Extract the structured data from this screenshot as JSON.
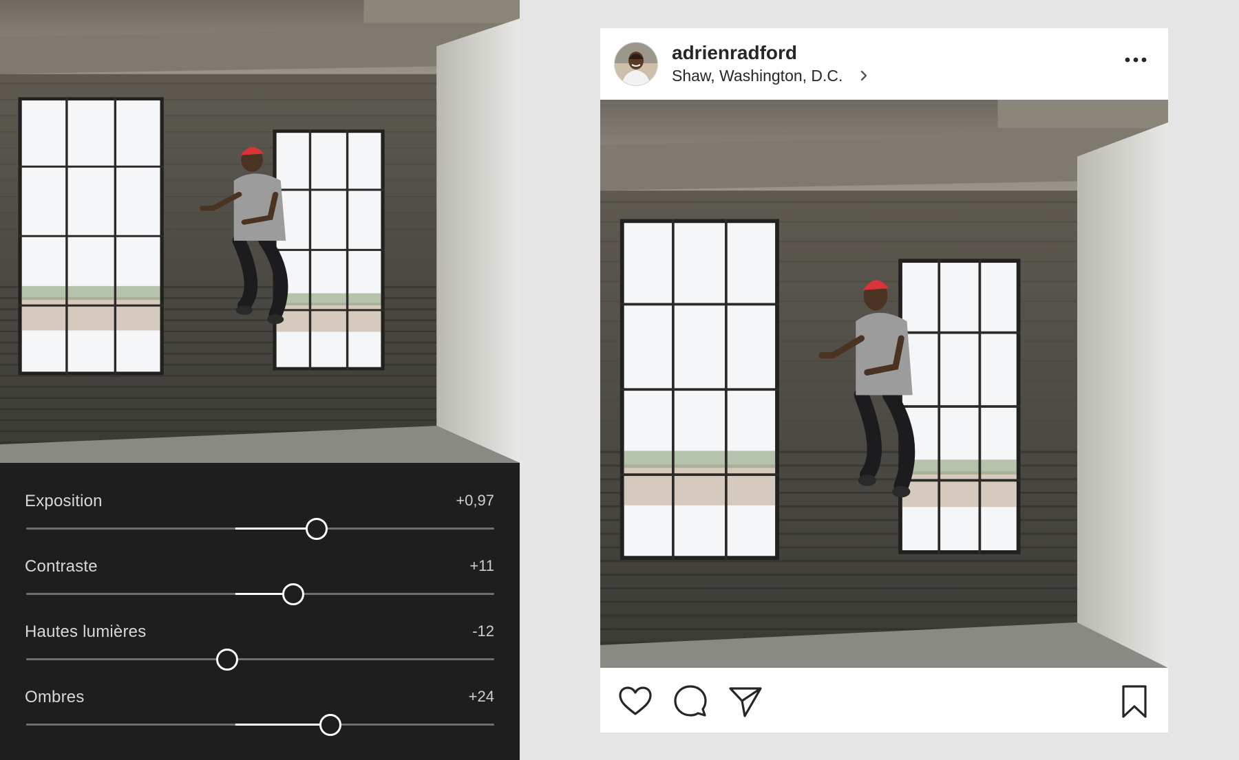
{
  "editor": {
    "adjustments": [
      {
        "label": "Exposition",
        "value": "+0,97",
        "level": 0.62
      },
      {
        "label": "Contraste",
        "value": "+11",
        "level": 0.57
      },
      {
        "label": "Hautes lumières",
        "value": "-12",
        "level": 0.43
      },
      {
        "label": "Ombres",
        "value": "+24",
        "level": 0.65
      }
    ]
  },
  "post": {
    "username": "adrienradford",
    "location": "Shaw, Washington, D.C."
  },
  "icons": {
    "more": "more-horizontal-icon",
    "like": "heart-icon",
    "comment": "comment-bubble-icon",
    "share": "paper-plane-icon",
    "save": "bookmark-icon",
    "location_chevron": "chevron-right-icon"
  },
  "colors": {
    "panel_bg": "#1e1e1e",
    "page_bg": "#e5e5e5",
    "cap_red": "#d9343a"
  }
}
